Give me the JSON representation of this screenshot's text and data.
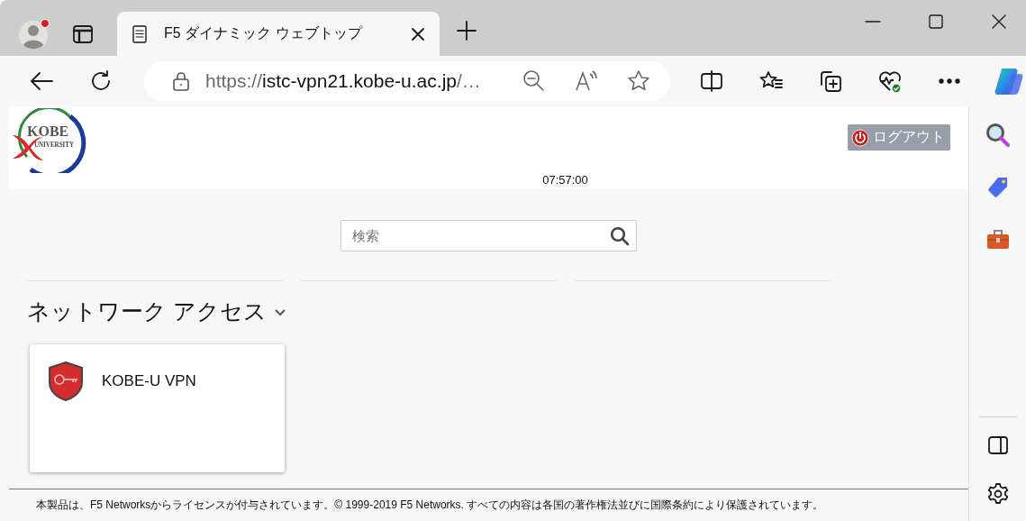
{
  "browser": {
    "tab": {
      "title": "F5 ダイナミック ウェブトップ"
    },
    "address": {
      "scheme": "https://",
      "host": "istc-vpn21.kobe-u.ac.jp",
      "rest": "/…"
    }
  },
  "page": {
    "logo": {
      "name": "KOBE",
      "subtitle": "UNIVERSITY"
    },
    "logout": "ログアウト",
    "time": "07:57:00",
    "search": {
      "placeholder": "検索"
    },
    "section": {
      "title": "ネットワーク アクセス",
      "expanded": true
    },
    "resources": [
      {
        "name": "KOBE-U VPN"
      }
    ],
    "footer": "本製品は、F5 Networksからライセンスが付与されています。© 1999-2019 F5 Networks. すべての内容は各国の著作権法並びに国際条約により保護されています。"
  }
}
